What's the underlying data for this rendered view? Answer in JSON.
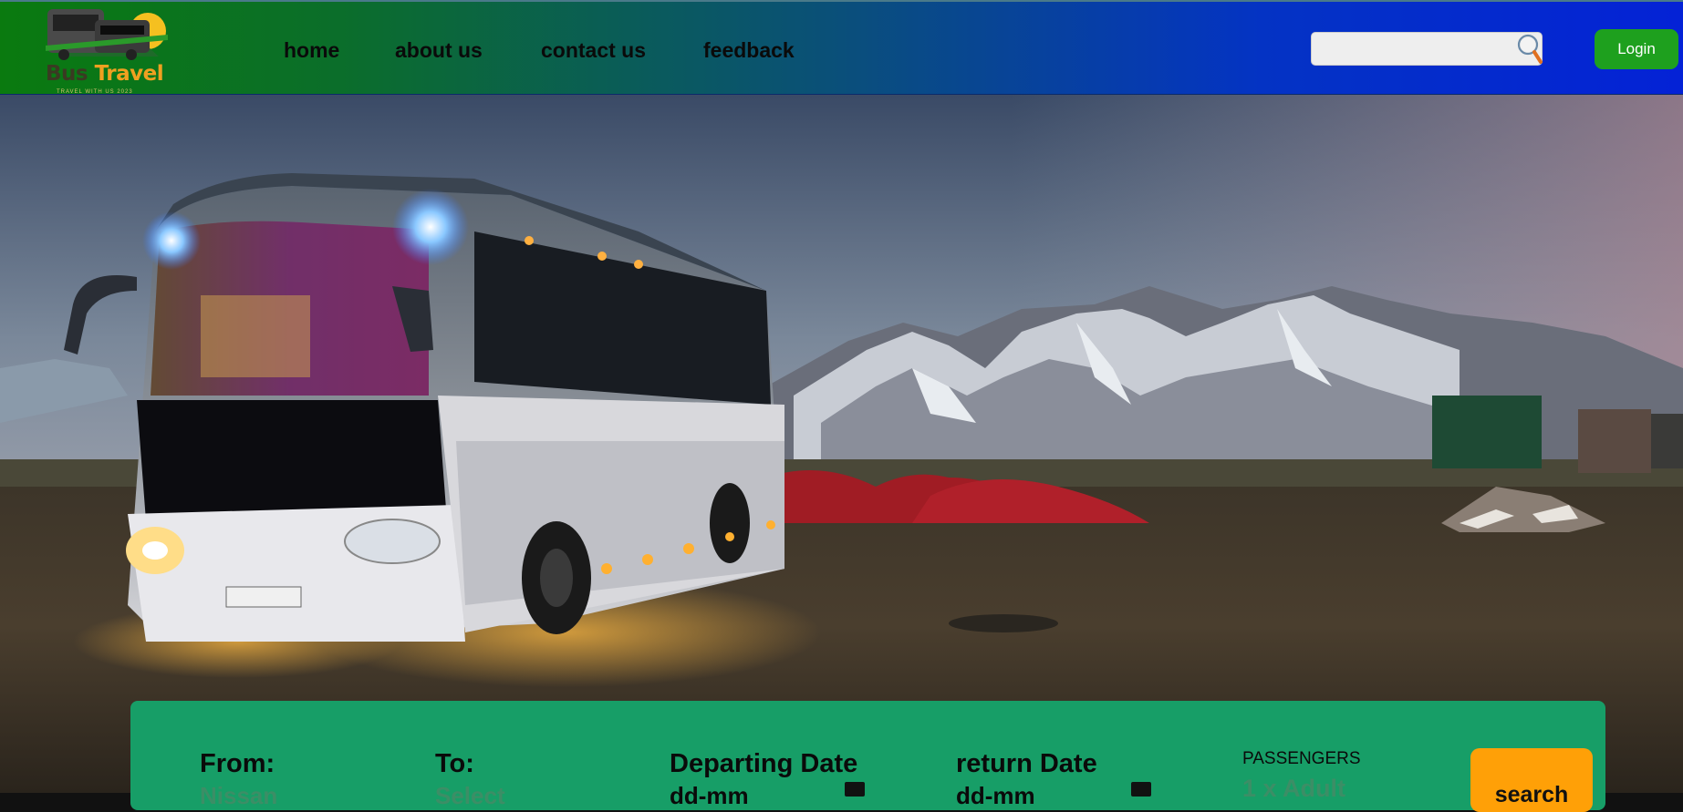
{
  "brand": {
    "logo_bus": "Bus",
    "logo_travel": "Travel",
    "logo_tagline": "TRAVEL WITH US 2023"
  },
  "nav": {
    "items": [
      {
        "label": "home"
      },
      {
        "label": "about us"
      },
      {
        "label": "contact us"
      },
      {
        "label": "feedback"
      }
    ]
  },
  "header": {
    "search_value": "",
    "search_placeholder": "",
    "login_label": "Login"
  },
  "booking": {
    "from_label": "From:",
    "from_value": "Nissan",
    "to_label": "To:",
    "to_value": "Select",
    "departing_label": "Departing Date",
    "departing_value": "dd-mm",
    "return_label": "return Date",
    "return_value": "dd-mm",
    "passengers_label": "PASSENGERS",
    "passengers_value": "1 x Adult",
    "search_label": "search"
  },
  "colors": {
    "nav_gradient_start": "#0a7a0f",
    "nav_gradient_end": "#0422d6",
    "login_button": "#1ea01e",
    "booking_panel": "#179e67",
    "search_button": "#ffa007"
  }
}
